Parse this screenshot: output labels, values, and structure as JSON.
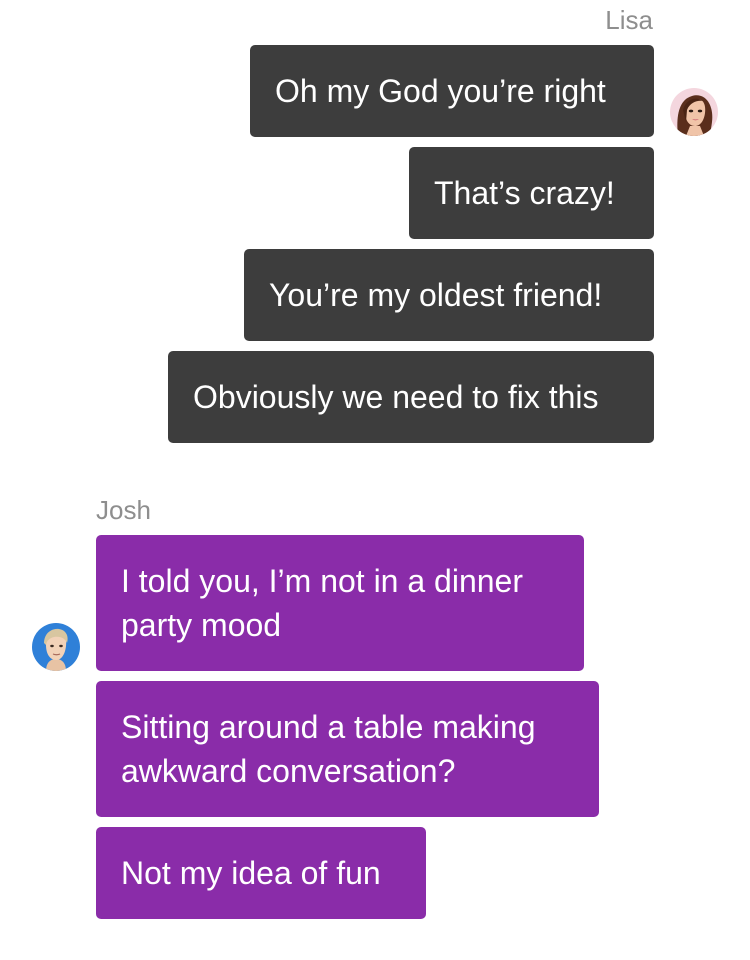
{
  "conversation": {
    "lisa": {
      "name": "Lisa",
      "avatar_icon": "woman-portrait-avatar",
      "messages": [
        "Oh my God you’re right",
        "That’s crazy!",
        "You’re my oldest friend!",
        "Obviously we need to fix this"
      ]
    },
    "josh": {
      "name": "Josh",
      "avatar_icon": "man-portrait-avatar",
      "messages": [
        "I told you, I’m not in a dinner party mood",
        "Sitting around a table making awkward conversation?",
        "Not my idea of fun"
      ]
    }
  },
  "colors": {
    "outgoing_bubble": "#3d3d3d",
    "incoming_bubble": "#8a2ca9",
    "sender_name": "#8e8e8e",
    "background": "#ffffff"
  }
}
